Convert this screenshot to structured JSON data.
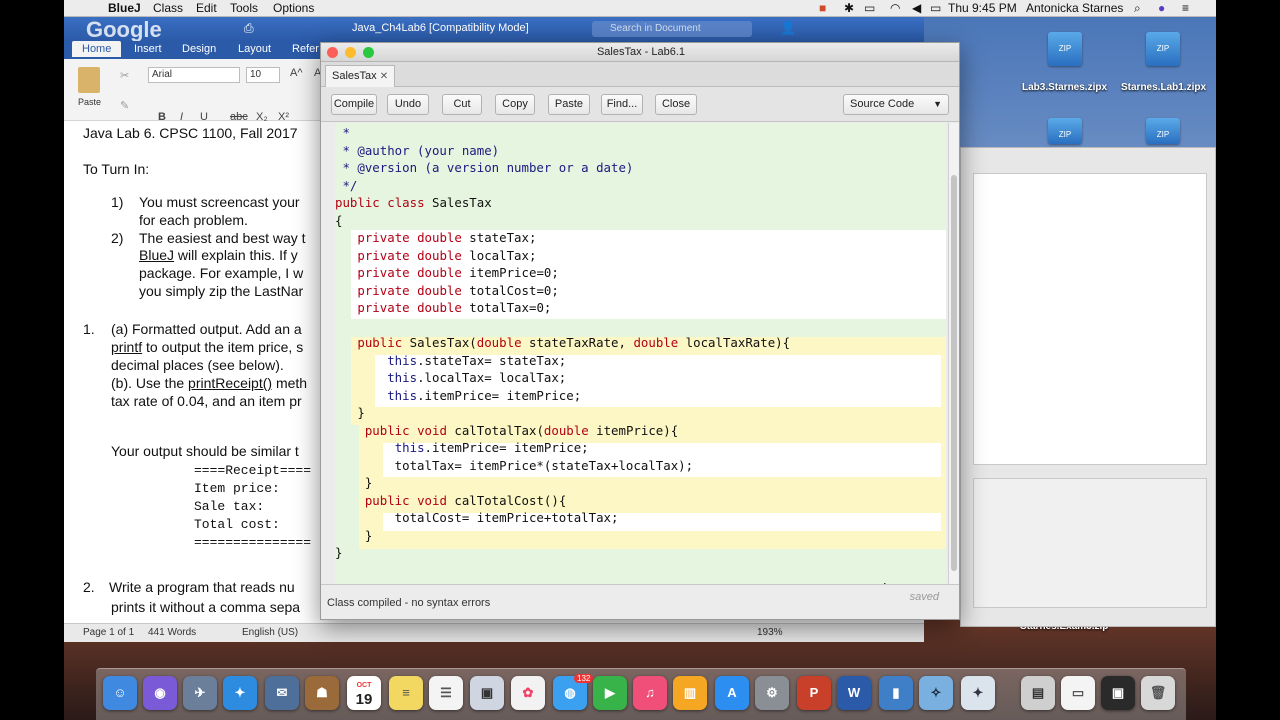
{
  "menubar": {
    "app": "BlueJ",
    "items": [
      "Class",
      "Edit",
      "Tools",
      "Options"
    ],
    "clock": "Thu 9:45 PM",
    "user": "Antonicka Starnes"
  },
  "desktop": {
    "icons": [
      {
        "label": "Lab3.Starnes.zipx"
      },
      {
        "label": "Starnes.Lab1.zipx"
      }
    ],
    "bottom_label": "Starnes.Exam3.zip"
  },
  "word": {
    "doc_title": "Java_Ch4Lab6 [Compatibility Mode]",
    "search_placeholder": "Search in Document",
    "tabs": [
      "Home",
      "Insert",
      "Design",
      "Layout",
      "Refer"
    ],
    "font_name": "Arial",
    "font_size": "10",
    "paste_label": "Paste",
    "content": {
      "heading": "Java Lab 6.  CPSC 1100, Fall 2017",
      "to_turn_in": "To Turn In:",
      "item1_num": "1)",
      "item1_line1": "You must screencast your",
      "item1_line2": "for each problem.",
      "item2_num": "2)",
      "item2_line1": "The easiest and best way t",
      "item2_line2a": "BlueJ",
      "item2_line2b": " will explain this.   If y",
      "item2_line3": "package.  For example, I w",
      "item2_line4": "you simply zip the LastNar",
      "p1_num": "1.",
      "p1_line1": "(a) Formatted output. Add an a",
      "p1_line2a": "printf",
      "p1_line2b": " to output the item price, s",
      "p1_line3": "decimal places (see below).",
      "p1_line4a": "(b). Use the ",
      "p1_line4b": "printReceipt()",
      "p1_line4c": " meth",
      "p1_line5": "tax rate of 0.04, and an item pr",
      "p1_output": "Your output should be similar t",
      "mono1": "====Receipt====",
      "mono2": "Item price:",
      "mono3": "Sale tax:",
      "mono4": "Total cost:",
      "mono5": "===============",
      "p2_num": "2.",
      "p2_line1": " Write a program that reads nu",
      "p2_line2": "prints it without a comma sepa"
    },
    "status": {
      "page": "Page 1 of 1",
      "words": "441 Words",
      "lang": "English (US)",
      "zoom": "193%"
    }
  },
  "bluej": {
    "window_title": "SalesTax - Lab6.1",
    "tab": "SalesTax",
    "toolbar": [
      "Compile",
      "Undo",
      "Cut",
      "Copy",
      "Paste",
      "Find...",
      "Close"
    ],
    "view_select": "Source Code",
    "status_msg": "Class compiled - no syntax errors",
    "saved": "saved",
    "code": [
      " *",
      " * @author (your name)",
      " * @version (a version number or a date)",
      " */",
      "public class SalesTax",
      "{",
      "   private double stateTax;",
      "   private double localTax;",
      "   private double itemPrice=0;",
      "   private double totalCost=0;",
      "   private double totalTax=0;",
      "",
      "   public SalesTax(double stateTaxRate, double localTaxRate){",
      "       this.stateTax= stateTax;",
      "       this.localTax= localTax;",
      "       this.itemPrice= itemPrice;",
      "   }",
      "    public void calTotalTax(double itemPrice){",
      "        this.itemPrice= itemPrice;",
      "        totalTax= itemPrice*(stateTax+localTax);",
      "    }",
      "    public void calTotalCost(){",
      "        totalCost= itemPrice+totalTax;",
      "    }",
      "}"
    ]
  },
  "dock": {
    "calendar_day": "19",
    "calendar_month": "OCT",
    "badge_messages": "132"
  },
  "colors": {
    "class_band": "#e6f5e0",
    "method_band": "#fcf7c4",
    "keyword": "#b30015",
    "word_blue": "#2b5aa8"
  }
}
